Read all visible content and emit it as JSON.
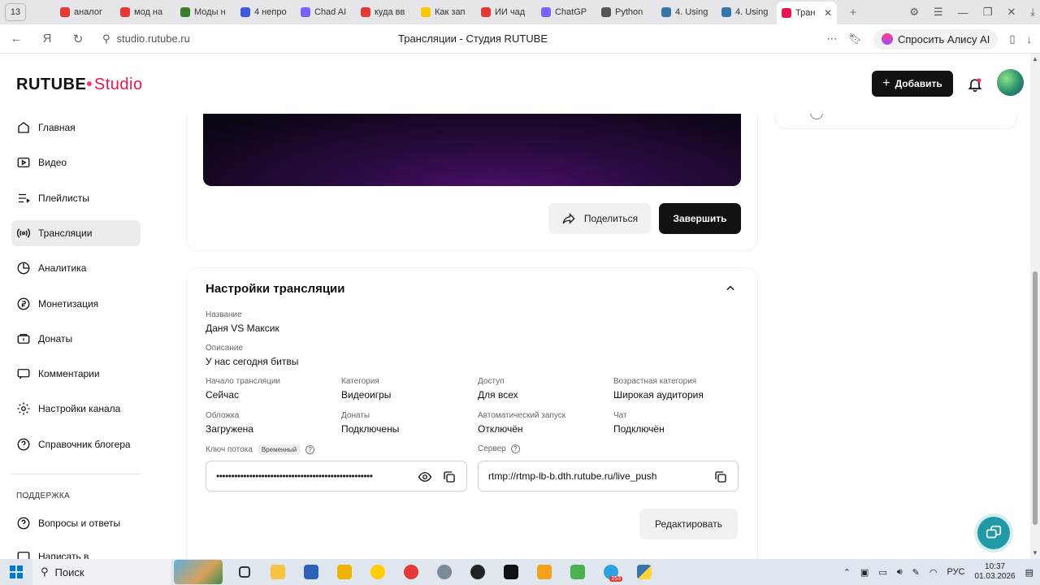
{
  "browser": {
    "tab_count": "13",
    "tabs": [
      {
        "label": "аналог",
        "color": "#e53935"
      },
      {
        "label": "мод на",
        "color": "#e53935"
      },
      {
        "label": "Моды н",
        "color": "#3a7d2c"
      },
      {
        "label": "4 непро",
        "color": "#3b5bdb"
      },
      {
        "label": "Chad AI",
        "color": "#7b61ff"
      },
      {
        "label": "куда вв",
        "color": "#e53935"
      },
      {
        "label": "Как зап",
        "color": "#f7c600"
      },
      {
        "label": "ИИ чад",
        "color": "#e53935"
      },
      {
        "label": "ChatGP",
        "color": "#7b61ff"
      },
      {
        "label": "Python",
        "color": "#555555"
      },
      {
        "label": "4. Using",
        "color": "#3776ab"
      },
      {
        "label": "4. Using",
        "color": "#3776ab"
      }
    ],
    "active_tab": {
      "label": "Тран",
      "color": "#e4184e"
    },
    "url": "studio.rutube.ru",
    "page_title": "Трансляции - Студия RUTUBE",
    "alice_label": "Спросить Алису AI"
  },
  "header": {
    "logo_main": "RUTUBE",
    "logo_dot": "•",
    "logo_studio": "Studio",
    "add_label": "Добавить"
  },
  "sidebar": {
    "items": [
      {
        "label": "Главная",
        "icon": "home-icon"
      },
      {
        "label": "Видео",
        "icon": "video-icon"
      },
      {
        "label": "Плейлисты",
        "icon": "playlist-icon"
      },
      {
        "label": "Трансляции",
        "icon": "broadcast-icon",
        "active": true
      },
      {
        "label": "Аналитика",
        "icon": "analytics-icon"
      },
      {
        "label": "Монетизация",
        "icon": "monetization-icon"
      },
      {
        "label": "Донаты",
        "icon": "donate-icon"
      },
      {
        "label": "Комментарии",
        "icon": "comments-icon"
      },
      {
        "label": "Настройки канала",
        "icon": "gear-icon"
      },
      {
        "label": "Справочник блогера",
        "icon": "help-icon"
      }
    ],
    "support_section": "ПОДДЕРЖКА",
    "support_items": [
      {
        "label": "Вопросы и ответы"
      },
      {
        "label": "Написать в"
      }
    ]
  },
  "stream": {
    "share_label": "Поделиться",
    "finish_label": "Завершить"
  },
  "settings": {
    "title": "Настройки трансляции",
    "name_label": "Название",
    "name_value": "Даня VS Максик",
    "description_label": "Описание",
    "description_value": "У нас сегодня битвы",
    "grid": [
      {
        "label": "Начало трансляции",
        "value": "Сейчас"
      },
      {
        "label": "Категория",
        "value": "Видеоигры"
      },
      {
        "label": "Доступ",
        "value": "Для всех"
      },
      {
        "label": "Возрастная категория",
        "value": "Широкая аудитория"
      },
      {
        "label": "Обложка",
        "value": "Загружена"
      },
      {
        "label": "Донаты",
        "value": "Подключены"
      },
      {
        "label": "Автоматический запуск",
        "value": "Отключён"
      },
      {
        "label": "Чат",
        "value": "Подключён"
      }
    ],
    "stream_key_label": "Ключ потока",
    "stream_key_badge": "Временный",
    "stream_key_value": "••••••••••••••••••••••••••••••••••••••••••••••••••••",
    "server_label": "Сервер",
    "server_value": "rtmp://rtmp-lb-b.dth.rutube.ru/live_push",
    "edit_label": "Редактировать"
  },
  "taskbar": {
    "search_label": "Поиск",
    "telegram_badge": "253",
    "language": "РУС",
    "time": "10:37",
    "date": "01.03.2026"
  }
}
